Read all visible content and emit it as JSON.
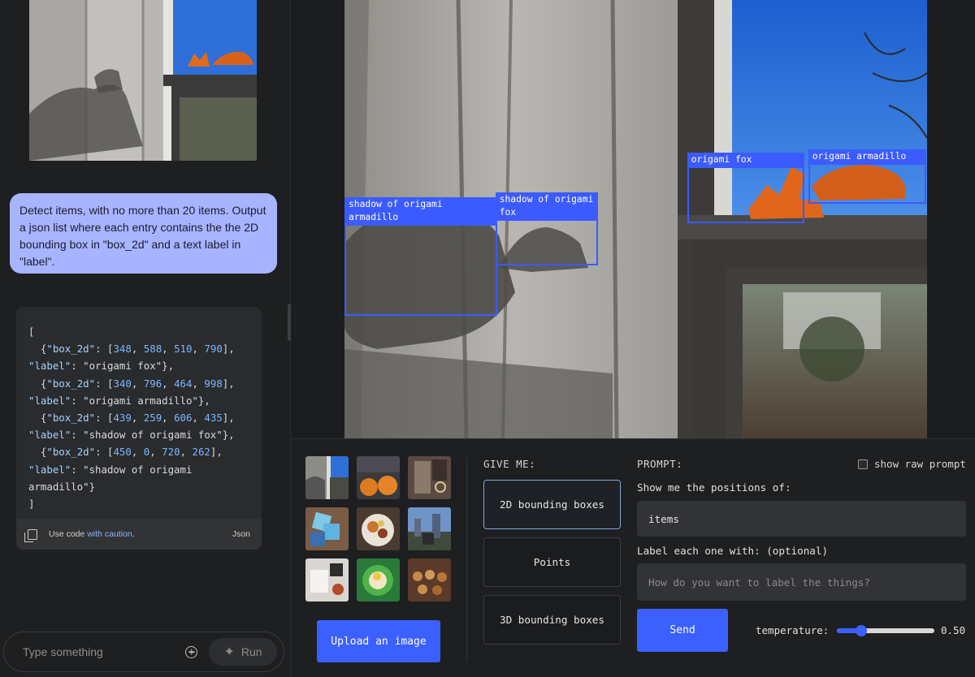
{
  "chat": {
    "user_message": "Detect items, with no more than 20 items. Output a json list where each entry contains the the 2D bounding box in \"box_2d\" and a text label in \"label\".",
    "code_lines": [
      "[",
      "  {\"box_2d\": [348, 588, 510, 790],",
      "\"label\": \"origami fox\"},",
      "  {\"box_2d\": [340, 796, 464, 998],",
      "\"label\": \"origami armadillo\"},",
      "  {\"box_2d\": [439, 259, 606, 435],",
      "\"label\": \"shadow of origami fox\"},",
      "  {\"box_2d\": [450, 0, 720, 262],",
      "\"label\": \"shadow of origami",
      "armadillo\"}",
      "]"
    ],
    "code_footer": {
      "prefix": "Use code ",
      "link": "with caution",
      "suffix": ".",
      "language": "Json"
    },
    "composer": {
      "placeholder": "Type something",
      "run_label": "Run"
    }
  },
  "detections": [
    {
      "label": "shadow of origami armadillo",
      "box_2d": [
        450,
        0,
        720,
        262
      ]
    },
    {
      "label": "shadow of origami fox",
      "box_2d": [
        439,
        259,
        606,
        435
      ]
    },
    {
      "label": "origami fox",
      "box_2d": [
        348,
        588,
        510,
        790
      ]
    },
    {
      "label": "origami armadillo",
      "box_2d": [
        340,
        796,
        464,
        998
      ]
    }
  ],
  "controls": {
    "upload_label": "Upload an image",
    "give_me_label": "GIVE ME:",
    "modes": [
      {
        "label": "2D bounding boxes",
        "active": true
      },
      {
        "label": "Points",
        "active": false
      },
      {
        "label": "3D bounding boxes",
        "active": false
      }
    ],
    "prompt_label": "PROMPT:",
    "show_raw_prompt_label": "show raw prompt",
    "show_raw_prompt_checked": false,
    "positions_label": "Show me the positions of:",
    "items_value": "items",
    "label_label": "Label each one with: (optional)",
    "label_placeholder": "How do you want to label the things?",
    "send_label": "Send",
    "temperature_label": "temperature:",
    "temperature_value": "0.50",
    "temperature_min": 0,
    "temperature_max": 2,
    "temperature": 0.5
  },
  "colors": {
    "accent": "#3a60ff",
    "bbox": "#3b5bff",
    "user_bubble": "#a8b4ff"
  }
}
